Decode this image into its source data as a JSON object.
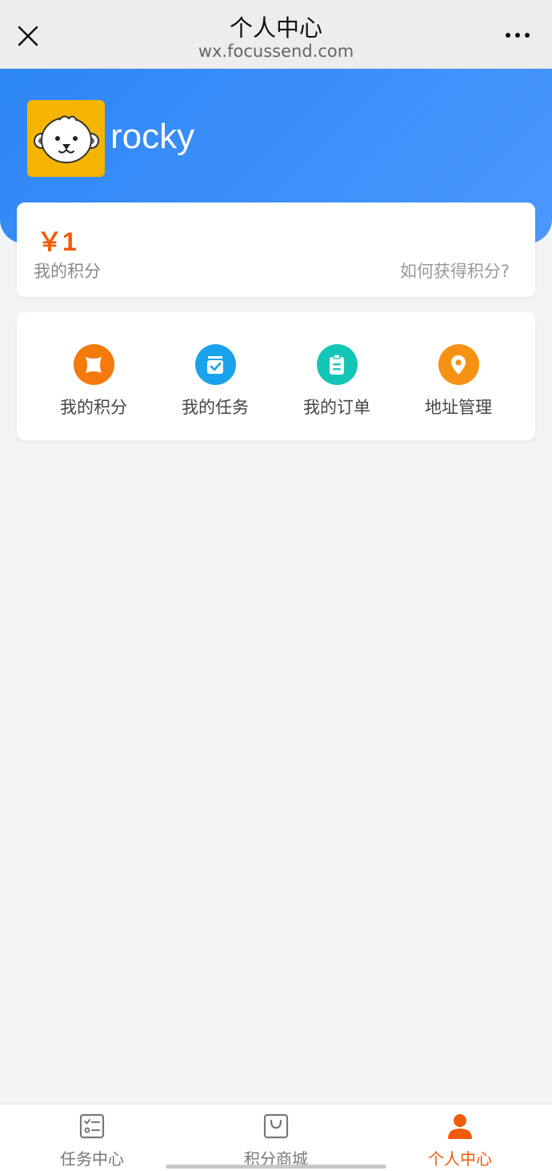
{
  "navbar": {
    "title": "个人中心",
    "url": "wx.focussend.com",
    "close_icon": "close-icon",
    "more_icon": "more-dots-icon"
  },
  "profile": {
    "username": "rocky",
    "avatar_icon": "otter-avatar"
  },
  "points": {
    "value": "￥1",
    "label": "我的积分",
    "help_link": "如何获得积分?"
  },
  "menu": {
    "items": [
      {
        "label": "我的积分",
        "icon": "points-icon",
        "color": "#f47a0c"
      },
      {
        "label": "我的任务",
        "icon": "task-check-icon",
        "color": "#1aa3ec"
      },
      {
        "label": "我的订单",
        "icon": "clipboard-icon",
        "color": "#12c6b6"
      },
      {
        "label": "地址管理",
        "icon": "location-pin-icon",
        "color": "#f69213"
      }
    ]
  },
  "tabbar": {
    "tabs": [
      {
        "label": "任务中心",
        "icon": "task-list-icon",
        "active": false
      },
      {
        "label": "积分商城",
        "icon": "shopping-bag-icon",
        "active": false
      },
      {
        "label": "个人中心",
        "icon": "person-icon",
        "active": true
      }
    ],
    "active_color": "#f15a0a"
  },
  "colors": {
    "header_blue": "#3b8ff7",
    "accent_orange": "#f15a0a",
    "background": "#f3f4f6"
  }
}
